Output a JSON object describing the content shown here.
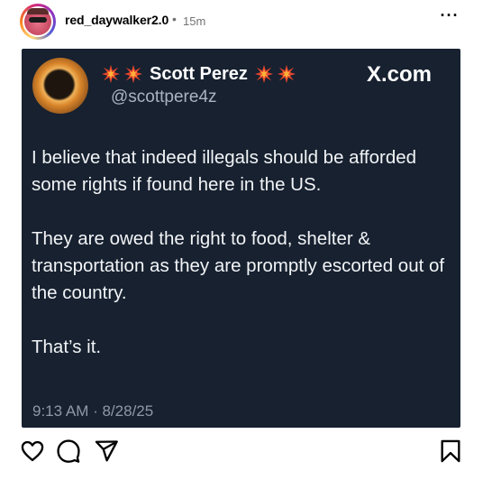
{
  "post": {
    "username": "red_daywalker2.0",
    "separator": "•",
    "time_ago": "15m",
    "more_label": "···"
  },
  "tweet": {
    "display_name": "Scott Perez",
    "handle": "@scottpere4z",
    "brand": "X.com",
    "paragraphs": [
      "I believe that indeed illegals should be afforded some rights if found here in the US.",
      "They are owed the right to food, shelter & transportation as they are promptly escorted out of the country.",
      "That’s it."
    ],
    "timestamp": "9:13 AM · 8/28/25",
    "name_decoration_icon": "collision-spark-icon",
    "colors": {
      "card_bg": "#172130",
      "text": "#f2f4f6",
      "muted": "#8e99a6",
      "spark": "#e8452c"
    }
  },
  "actions": {
    "icons": [
      "heart-icon",
      "comment-icon",
      "share-icon",
      "bookmark-icon"
    ]
  }
}
